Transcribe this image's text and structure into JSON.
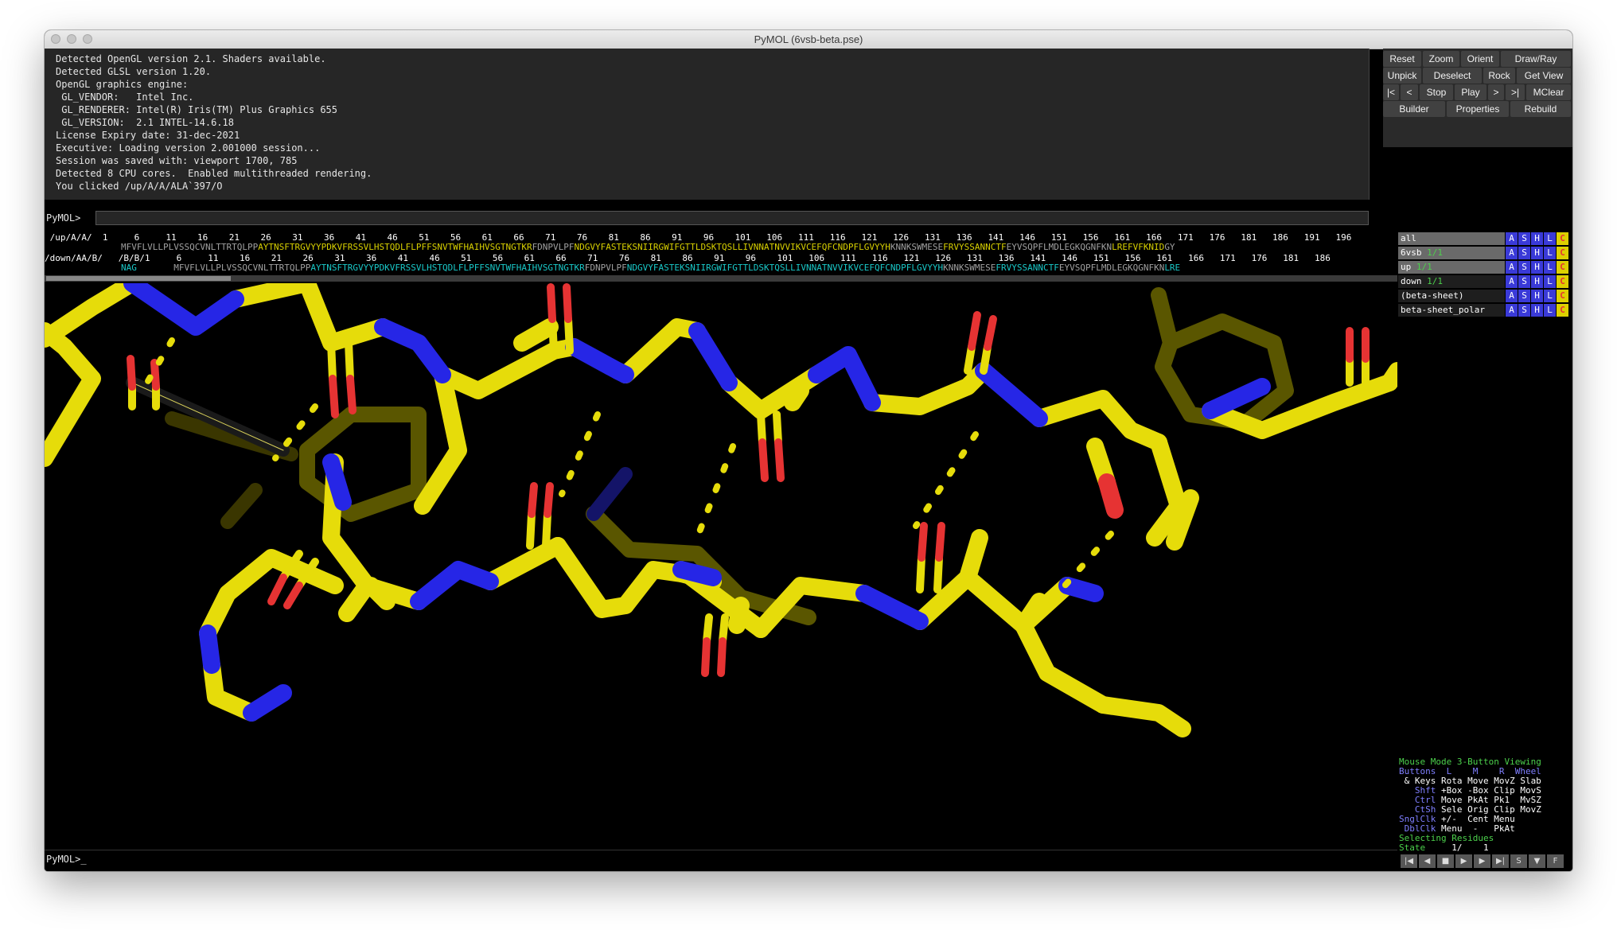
{
  "window": {
    "title": "PyMOL (6vsb-beta.pse)"
  },
  "console": {
    "lines": [
      "Detected OpenGL version 2.1. Shaders available.",
      "Detected GLSL version 1.20.",
      "OpenGL graphics engine:",
      " GL_VENDOR:   Intel Inc.",
      " GL_RENDERER: Intel(R) Iris(TM) Plus Graphics 655",
      " GL_VERSION:  2.1 INTEL-14.6.18",
      "License Expiry date: 31-dec-2021",
      "Executive: Loading version 2.001000 session...",
      "Session was saved with: viewport 1700, 785",
      "Detected 8 CPU cores.  Enabled multithreaded rendering.",
      "You clicked /up/A/A/ALA`397/O"
    ],
    "prompt": "PyMOL>",
    "input_value": ""
  },
  "buttons": {
    "row1": [
      "Reset",
      "Zoom",
      "Orient",
      "Draw/Ray"
    ],
    "row2": [
      "Unpick",
      "Deselect",
      "Rock",
      "Get View"
    ],
    "row3": [
      "|<",
      "<",
      "Stop",
      "Play",
      ">",
      ">|",
      "MClear"
    ],
    "row4": [
      "Builder",
      "Properties",
      "Rebuild"
    ]
  },
  "sequence": {
    "line1_numbers": " /up/A/A/  1     6     11    16    21    26    31    36    41    46    51    56    61    66    71    76    81    86    91    96    101   106   111   116   121   126   131   136   141   146   151   156   161   166   171   176   181   186   191   196",
    "line1_seq": "MFVFLVLLPLVSSQCVNLTTRTQLPPAYTNSFTRGVYYPDKVFRSSVLHSTQDLFLPFFSNVTWFHAIHVSGTNGTKRFDNPVLPFNDGVYFASTEKSNIIRGWIFGTTLDSKTQSLLIVNNATNVVIKVCEFQFCNDPFLGVYYHKNNKSWMESEFRVYSSANNCTFEYVSQPFLMDLEGKQGNFKNLREFVFKNIDGY",
    "line2_numbers": "/down/AA/B/   /B/B/1     6     11    16    21    26    31    36    41    46    51    56    61    66    71    76    81    86    91    96    101   106   111   116   121   126   131   136   141   146   151   156   161   166   171   176   181   186",
    "line2_prefix": "NAG",
    "line2_seq": "MFVFLVLLPLVSSQCVNLTTRTQLPPAYTNSFTRGVYYPDKVFRSSVLHSTQDLFLPFFSNVTWFHAIHVSGTNGTKRFDNPVLPFNDGVYFASTEKSNIIRGWIFGTTLDSKTQSLLIVNNATNVVIKVCEFQFCNDPFLGVYYHKNNKSWMESEFRVYSSANNCTFEYVSQPFLMDLEGKQGNFKNLRE"
  },
  "objects": [
    {
      "name": "all",
      "state": "",
      "enabled": true
    },
    {
      "name": "6vsb",
      "state": "1/1",
      "enabled": true
    },
    {
      "name": "up",
      "state": "1/1",
      "enabled": true
    },
    {
      "name": "down",
      "state": "1/1",
      "enabled": false
    },
    {
      "name": "(beta-sheet)",
      "state": "",
      "enabled": false
    },
    {
      "name": "beta-sheet_polar",
      "state": "",
      "enabled": false
    }
  ],
  "object_actions": [
    "A",
    "S",
    "H",
    "L",
    "C"
  ],
  "mouse_help": {
    "title_left": "Mouse Mode",
    "title_right": "3-Button Viewing",
    "header1": "Buttons  L    M    R  Wheel",
    "header2": " & Keys Rota Move MovZ Slab",
    "rows": [
      [
        "Shft",
        "+Box -Box Clip MovS"
      ],
      [
        "Ctrl",
        "Move PkAt Pk1  MvSZ"
      ],
      [
        "CtSh",
        "Sele Orig Clip MovZ"
      ],
      [
        "SnglClk",
        "+/-  Cent Menu"
      ],
      [
        "DblClk",
        "Menu  -   PkAt"
      ]
    ],
    "selecting": "Selecting",
    "selecting_value": "Residues",
    "state_label": "State",
    "state_value": "1/    1"
  },
  "bottom_prompt": "PyMOL>_",
  "movie_controls": [
    "|◀",
    "◀",
    "■",
    "▶",
    "▶",
    "▶|",
    "S",
    "▼",
    "F"
  ],
  "colors": {
    "carbon": "#e6dc0a",
    "nitrogen": "#2626e6",
    "oxygen": "#e63333",
    "hbond": "#e6dc0a",
    "panel": "#262626"
  }
}
